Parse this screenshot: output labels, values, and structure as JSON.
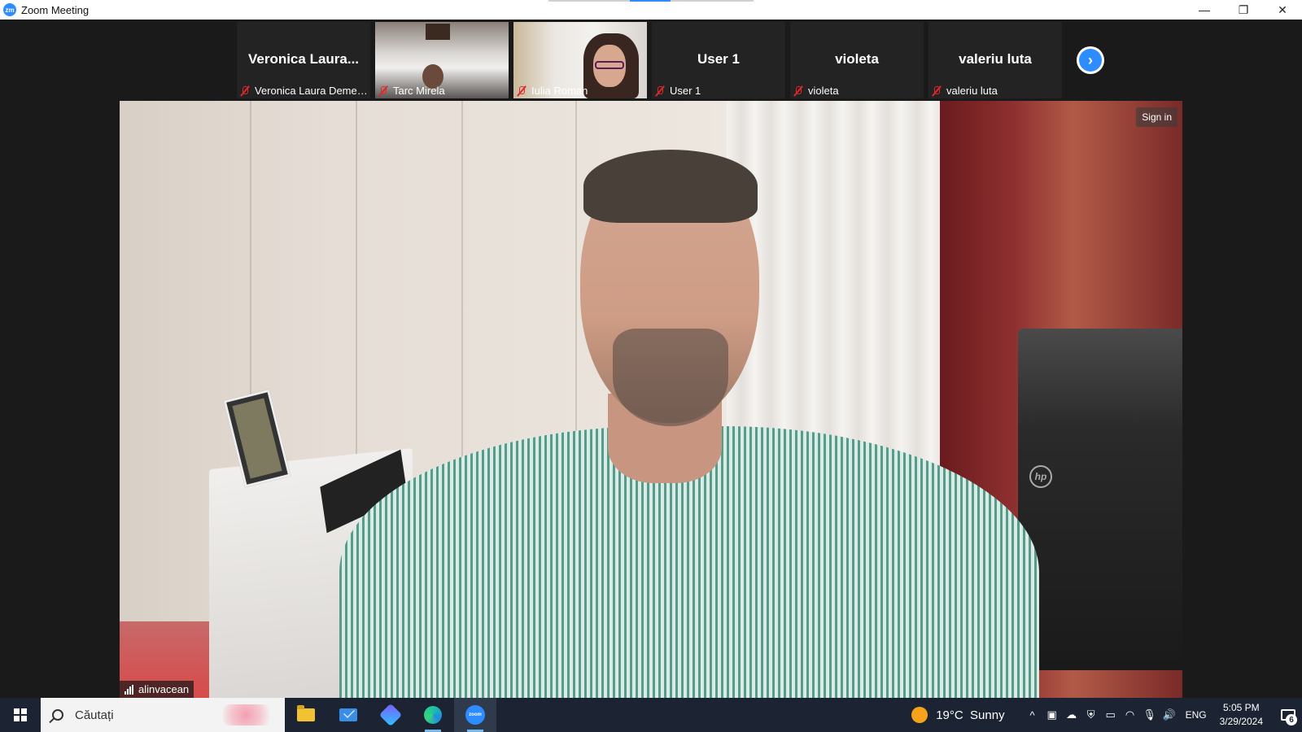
{
  "window": {
    "title": "Zoom Meeting",
    "logo_text": "zm",
    "minimize_glyph": "—",
    "restore_glyph": "❐",
    "close_glyph": "✕"
  },
  "participants": [
    {
      "display_name": "Veronica Laura...",
      "label": "Veronica Laura Demen...",
      "muted": true,
      "video": false
    },
    {
      "display_name": "",
      "label": "Tarc Mirela",
      "muted": true,
      "video": true
    },
    {
      "display_name": "",
      "label": "Iulia Roman",
      "muted": true,
      "video": true
    },
    {
      "display_name": "User 1",
      "label": "User 1",
      "muted": true,
      "video": false
    },
    {
      "display_name": "violeta",
      "label": "violeta",
      "muted": true,
      "video": false
    },
    {
      "display_name": "valeriu luta",
      "label": "valeriu luta",
      "muted": true,
      "video": false
    }
  ],
  "strip": {
    "next_glyph": "›"
  },
  "main_video": {
    "speaker": "alinvacean",
    "sign_in_label": "Sign in",
    "printer_logo": "hp"
  },
  "taskbar": {
    "search_placeholder": "Căutați",
    "zoom_icon_text": "zoom",
    "weather": {
      "temp": "19°C",
      "condition": "Sunny"
    },
    "tray": {
      "chevron_glyph": "^",
      "meet_glyph": "▣",
      "cloud_glyph": "☁",
      "security_glyph": "⛨",
      "battery_glyph": "▭",
      "network_glyph": "◠",
      "mic_glyph": "🎙",
      "volume_glyph": "🔊"
    },
    "language": "ENG",
    "time": "5:05 PM",
    "date": "3/29/2024",
    "notification_count": "6"
  },
  "colors": {
    "zoom_blue": "#2d8cff",
    "mute_red": "#e02828",
    "taskbar_bg": "#1c2433"
  }
}
